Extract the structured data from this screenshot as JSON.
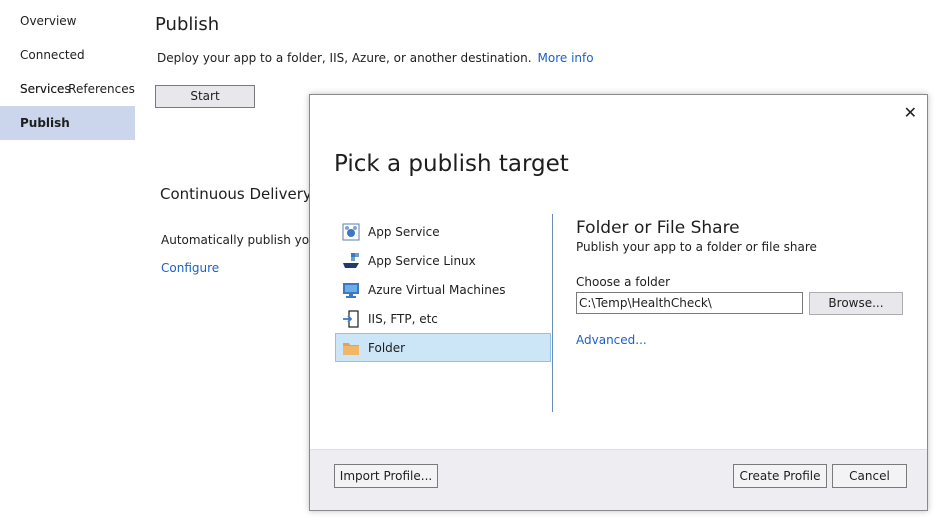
{
  "nav": {
    "items": [
      {
        "label": "Overview"
      },
      {
        "label": "Connected Services"
      },
      {
        "label": "Service References"
      },
      {
        "label": "Publish"
      }
    ]
  },
  "publish": {
    "title": "Publish",
    "description": "Deploy your app to a folder, IIS, Azure, or another destination.",
    "more_info": "More info",
    "start_label": "Start"
  },
  "continuous_delivery": {
    "title": "Continuous Delivery",
    "description": "Automatically publish your",
    "configure": "Configure"
  },
  "dialog": {
    "title": "Pick a publish target",
    "close": "✕",
    "targets": [
      {
        "label": "App Service",
        "icon": "app-service-icon"
      },
      {
        "label": "App Service Linux",
        "icon": "app-service-linux-icon"
      },
      {
        "label": "Azure Virtual Machines",
        "icon": "azure-vm-icon"
      },
      {
        "label": "IIS, FTP, etc",
        "icon": "iis-ftp-icon"
      },
      {
        "label": "Folder",
        "icon": "folder-icon"
      }
    ],
    "detail": {
      "title": "Folder or File Share",
      "subtitle": "Publish your app to a folder or file share",
      "choose_label": "Choose a folder",
      "folder_value": "C:\\Temp\\HealthCheck\\",
      "browse_label": "Browse...",
      "advanced_label": "Advanced..."
    },
    "footer": {
      "import_label": "Import Profile...",
      "create_label": "Create Profile",
      "cancel_label": "Cancel"
    }
  },
  "colors": {
    "accent_link": "#1a60c8",
    "nav_active": "#cbd6ec",
    "target_selected": "#cde6f7"
  }
}
